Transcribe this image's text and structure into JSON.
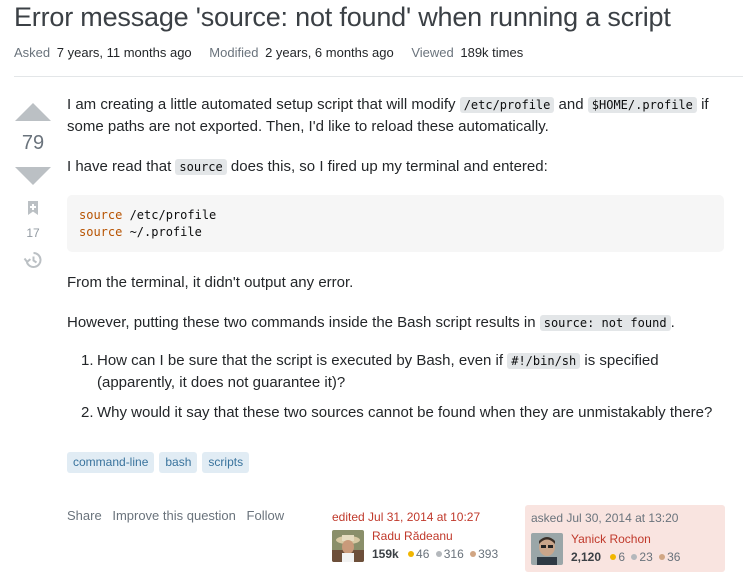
{
  "question": {
    "title": "Error message 'source: not found' when running a script",
    "meta": {
      "asked_label": "Asked",
      "asked_value": "7 years, 11 months ago",
      "modified_label": "Modified",
      "modified_value": "2 years, 6 months ago",
      "viewed_label": "Viewed",
      "viewed_value": "189k times"
    },
    "score": "79",
    "bookmark_count": "17"
  },
  "body": {
    "p1_a": "I am creating a little automated setup script that will modify ",
    "p1_code1": "/etc/profile",
    "p1_b": " and ",
    "p1_code2": "$HOME/.profile",
    "p1_c": " if some paths are not exported. Then, I'd like to reload these automatically.",
    "p2_a": "I have read that ",
    "p2_code": "source",
    "p2_b": " does this, so I fired up my terminal and entered:",
    "code_lines": [
      {
        "kw": "source",
        "rest": " /etc/profile"
      },
      {
        "kw": "source",
        "rest": " ~/.profile"
      }
    ],
    "p3": "From the terminal, it didn't output any error.",
    "p4_a": "However, putting these two commands inside the Bash script results in ",
    "p4_code": "source: not found",
    "p4_b": ".",
    "list": [
      {
        "num": "1.",
        "a": "How can I be sure that the script is executed by Bash, even if ",
        "code": "#!/bin/sh",
        "b": " is specified (apparently, it does not guarantee it)?"
      },
      {
        "num": "2.",
        "a": "Why would it say that these two sources cannot be found when they are unmistakably there?"
      }
    ]
  },
  "tags": [
    "command-line",
    "bash",
    "scripts"
  ],
  "actions": {
    "share": "Share",
    "improve": "Improve this question",
    "follow": "Follow"
  },
  "editor": {
    "when": "edited Jul 31, 2014 at 10:27",
    "name": "Radu Rădeanu",
    "rep": "159k",
    "gold": "46",
    "silver": "316",
    "bronze": "393"
  },
  "asker": {
    "when": "asked Jul 30, 2014 at 13:20",
    "name": "Yanick Rochon",
    "rep": "2,120",
    "gold": "6",
    "silver": "23",
    "bronze": "36"
  },
  "colors": {
    "accent_link": "#c0392b",
    "tag_bg": "#e1ecf4",
    "tag_text": "#39739d",
    "gold": "#f1b600",
    "silver": "#b4b8bc",
    "bronze": "#d1a684",
    "asker_bg": "#f9e4e0"
  },
  "icons": {
    "upvote": "triangle-up",
    "downvote": "triangle-down",
    "bookmark": "bookmark-icon",
    "history": "history-icon"
  }
}
